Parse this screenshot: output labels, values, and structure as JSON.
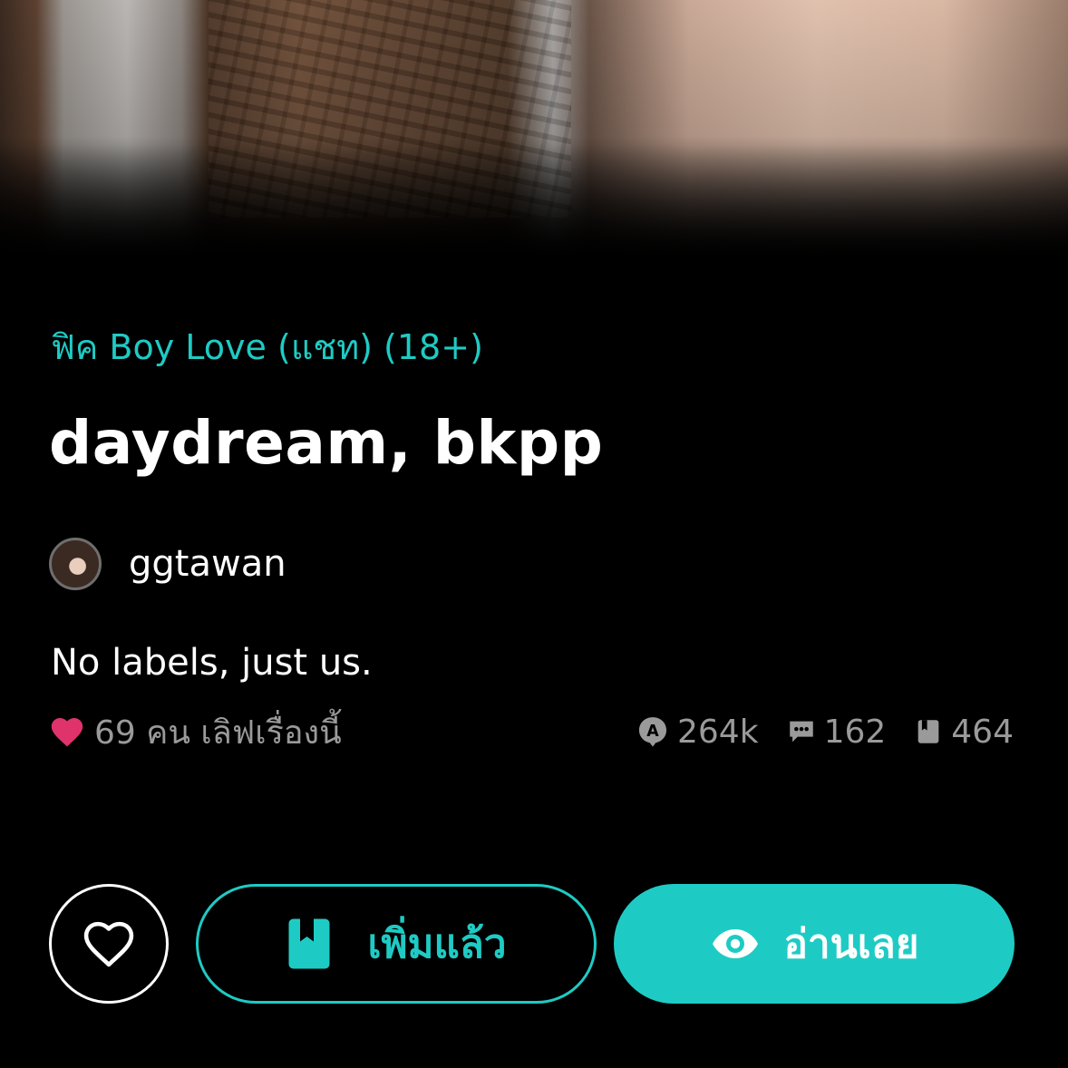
{
  "story": {
    "category": "ฟิค Boy Love (แชท) (18+)",
    "title": "daydream, bkpp",
    "author": "ggtawan",
    "description": "No labels, just us."
  },
  "stats": {
    "love_text": "69 คน เลิฟเรื่องนี้",
    "views": "264k",
    "comments": "162",
    "chapters": "464"
  },
  "actions": {
    "add_label": "เพิ่มแล้ว",
    "read_label": "อ่านเลย"
  },
  "colors": {
    "accent": "#1ecbc4",
    "heart": "#e0336b",
    "muted": "#9a9a9a",
    "background": "#000000"
  },
  "icons": {
    "like": "heart-outline-icon",
    "love": "heart-filled-icon",
    "views": "view-badge-icon",
    "comments": "comment-icon",
    "chapters": "book-icon",
    "add": "bookmark-book-icon",
    "read": "eye-icon"
  }
}
